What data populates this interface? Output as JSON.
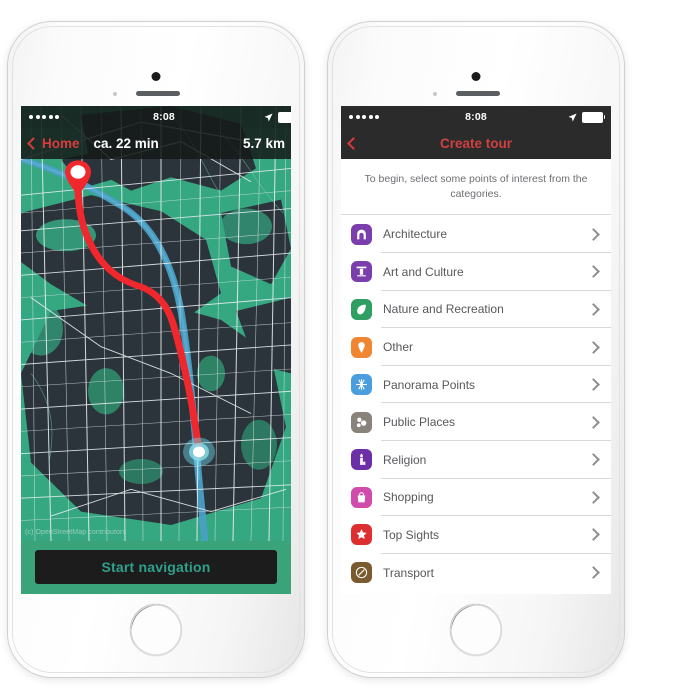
{
  "page": {
    "background": "#ffffff"
  },
  "phones": {
    "left": {
      "name": "navigation-phone",
      "statusbar": {
        "signal_dots": 5,
        "time": "8:08",
        "location_icon": "location-arrow-icon",
        "battery_icon": "battery-icon"
      },
      "navbar": {
        "back_label": "Home",
        "back_icon": "chevron-left-icon",
        "eta": "ca. 22 min",
        "distance": "5.7 km",
        "accent": "#d93b3b"
      },
      "map": {
        "attribution": "(c) OpenStreetMap contributors",
        "land_color": "#2b333b",
        "green_color": "#35a882",
        "water_color": "#4a9fc4",
        "road_color": "#e8eef0",
        "route_color": "#f0282d",
        "destination_pin": "map-pin-icon",
        "current_location": "current-location-dot"
      },
      "start_button": {
        "label": "Start navigation",
        "text_color": "#2fa08a",
        "background": "#1c1c1c"
      }
    },
    "right": {
      "name": "create-tour-phone",
      "statusbar": {
        "signal_dots": 5,
        "time": "8:08",
        "location_icon": "location-arrow-icon",
        "battery_icon": "battery-icon"
      },
      "navbar": {
        "back_icon": "chevron-left-icon",
        "title": "Create tour",
        "accent": "#cf4040"
      },
      "intro_text": "To begin, select some points of interest from the categories.",
      "categories": [
        {
          "label": "Architecture",
          "icon": "architecture-icon",
          "color": "#7b3fad",
          "chevron": "chevron-right-icon"
        },
        {
          "label": "Art and Culture",
          "icon": "column-icon",
          "color": "#7b3fad",
          "chevron": "chevron-right-icon"
        },
        {
          "label": "Nature and Recreation",
          "icon": "leaf-icon",
          "color": "#2e9e63",
          "chevron": "chevron-right-icon"
        },
        {
          "label": "Other",
          "icon": "map-pin-icon",
          "color": "#f08631",
          "chevron": "chevron-right-icon"
        },
        {
          "label": "Panorama Points",
          "icon": "panorama-star-icon",
          "color": "#4a9ede",
          "chevron": "chevron-right-icon"
        },
        {
          "label": "Public Places",
          "icon": "public-places-icon",
          "color": "#8a837c",
          "chevron": "chevron-right-icon"
        },
        {
          "label": "Religion",
          "icon": "candle-icon",
          "color": "#6d2fa8",
          "chevron": "chevron-right-icon"
        },
        {
          "label": "Shopping",
          "icon": "shopping-bag-icon",
          "color": "#d04bab",
          "chevron": "chevron-right-icon"
        },
        {
          "label": "Top Sights",
          "icon": "star-icon",
          "color": "#dd2f2f",
          "chevron": "chevron-right-icon"
        },
        {
          "label": "Transport",
          "icon": "transport-icon",
          "color": "#7a5a2e",
          "chevron": "chevron-right-icon"
        }
      ]
    }
  }
}
